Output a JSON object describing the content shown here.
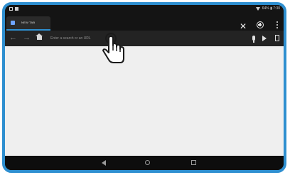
{
  "status_bar": {
    "text": "64% ▮ 7:30"
  },
  "browser": {
    "tab": {
      "title": "NEW TAB",
      "accent_color": "#2e8fd0"
    },
    "toolbar": {
      "back_icon": "arrow-left-icon",
      "forward_icon": "arrow-right-icon",
      "home_icon": "home-icon",
      "omnibox_placeholder": "Enter a search or an URL",
      "mic_icon": "mic-icon",
      "play_icon": "play-icon",
      "bookmark_icon": "bookmark-icon"
    },
    "header_icons": [
      "close-icon",
      "plus-circle-icon",
      "more-vertical-icon"
    ]
  },
  "system_nav": [
    "back-icon",
    "home-icon",
    "recents-icon"
  ],
  "cursor": "pointer-hand-icon",
  "colors": {
    "frame": "#2e8fd0",
    "page_background": "#efefef",
    "chrome_dark": "#1e1e1e"
  }
}
